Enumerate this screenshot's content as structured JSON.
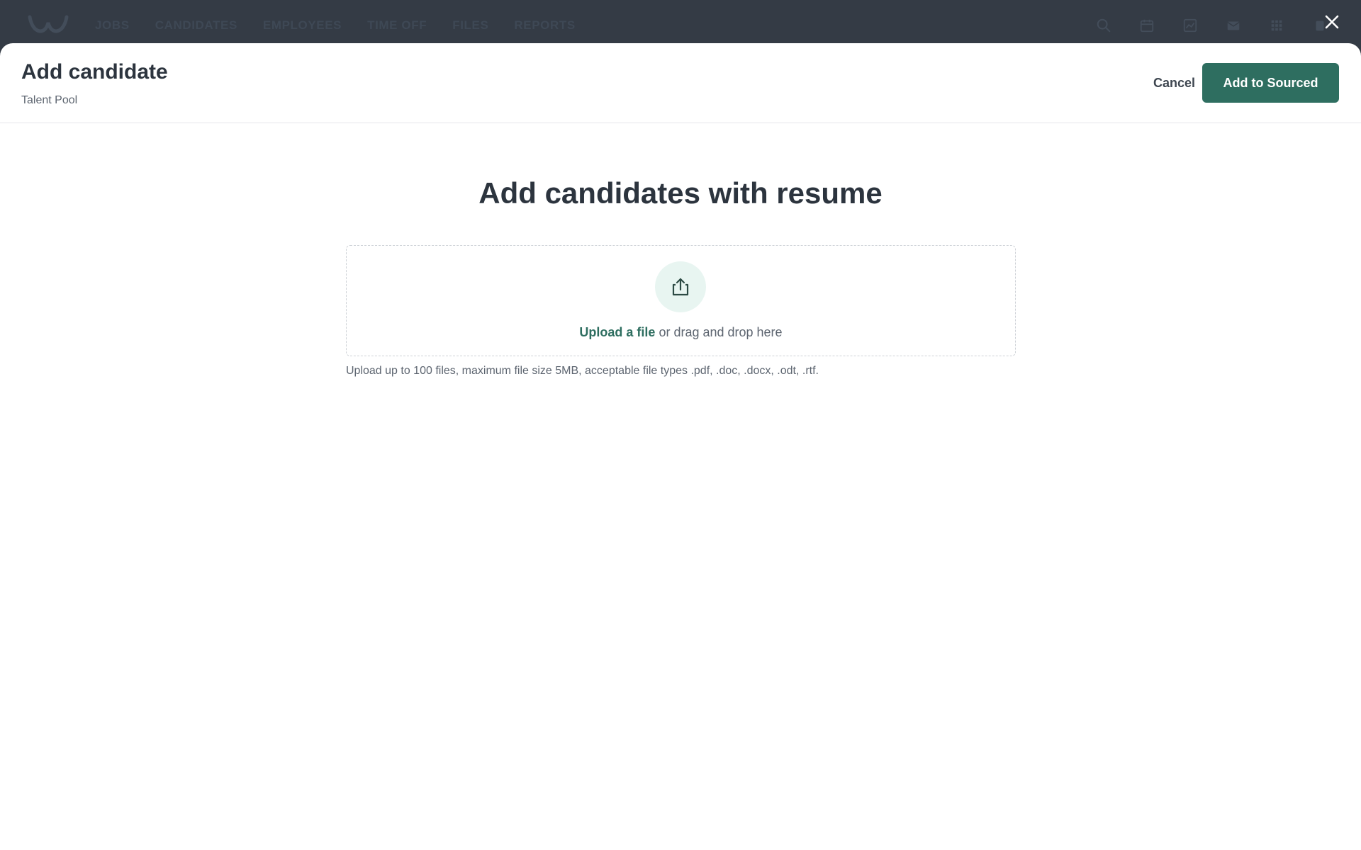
{
  "nav": {
    "items": [
      "JOBS",
      "CANDIDATES",
      "EMPLOYEES",
      "TIME OFF",
      "FILES",
      "REPORTS"
    ],
    "icons": [
      "search-icon",
      "calendar-icon",
      "chart-icon",
      "mail-icon",
      "apps-grid-icon",
      "notification-icon"
    ]
  },
  "modal": {
    "title": "Add candidate",
    "subtitle": "Talent Pool",
    "cancel_label": "Cancel",
    "primary_label": "Add to Sourced",
    "close_icon": "close-icon"
  },
  "upload": {
    "heading": "Add candidates with resume",
    "link_label": "Upload a file",
    "drop_text": " or drag and drop here",
    "hint": "Upload up to 100 files, maximum file size 5MB, acceptable file types .pdf, .doc, .docx, .odt, .rtf.",
    "icon": "upload-icon"
  },
  "colors": {
    "accent": "#2e6e60",
    "nav_background": "#343b45",
    "upload_circle_bg": "#e8f5f1"
  }
}
